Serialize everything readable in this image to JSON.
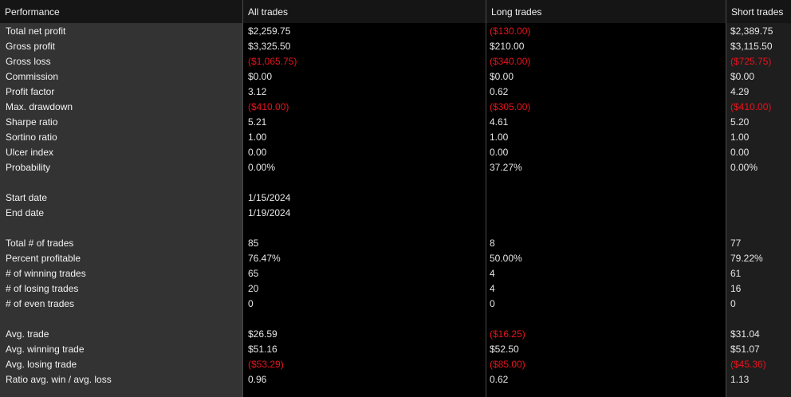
{
  "headers": {
    "performance": "Performance",
    "all": "All trades",
    "long": "Long trades",
    "short": "Short trades"
  },
  "colors": {
    "negative": "#e8141d",
    "label_column_bg": "#333333",
    "value_bg": "#000000",
    "short_column_bg": "#1e1e1e"
  },
  "rows": [
    {
      "label": "Total net profit",
      "all": "$2,259.75",
      "long": "($130.00)",
      "short": "$2,389.75"
    },
    {
      "label": "Gross profit",
      "all": "$3,325.50",
      "long": "$210.00",
      "short": "$3,115.50"
    },
    {
      "label": "Gross loss",
      "all": "($1,065.75)",
      "long": "($340.00)",
      "short": "($725.75)"
    },
    {
      "label": "Commission",
      "all": "$0.00",
      "long": "$0.00",
      "short": "$0.00"
    },
    {
      "label": "Profit factor",
      "all": "3.12",
      "long": "0.62",
      "short": "4.29"
    },
    {
      "label": "Max. drawdown",
      "all": "($410.00)",
      "long": "($305.00)",
      "short": "($410.00)"
    },
    {
      "label": "Sharpe ratio",
      "all": "5.21",
      "long": "4.61",
      "short": "5.20"
    },
    {
      "label": "Sortino ratio",
      "all": "1.00",
      "long": "1.00",
      "short": "1.00"
    },
    {
      "label": "Ulcer index",
      "all": "0.00",
      "long": "0.00",
      "short": "0.00"
    },
    {
      "label": "Probability",
      "all": "0.00%",
      "long": "37.27%",
      "short": "0.00%"
    },
    {
      "label": "",
      "all": "",
      "long": "",
      "short": ""
    },
    {
      "label": "Start date",
      "all": "1/15/2024",
      "long": "",
      "short": ""
    },
    {
      "label": "End date",
      "all": "1/19/2024",
      "long": "",
      "short": ""
    },
    {
      "label": "",
      "all": "",
      "long": "",
      "short": ""
    },
    {
      "label": "Total # of trades",
      "all": "85",
      "long": "8",
      "short": "77"
    },
    {
      "label": "Percent profitable",
      "all": "76.47%",
      "long": "50.00%",
      "short": "79.22%"
    },
    {
      "label": "# of winning trades",
      "all": "65",
      "long": "4",
      "short": "61"
    },
    {
      "label": "# of losing trades",
      "all": "20",
      "long": "4",
      "short": "16"
    },
    {
      "label": "# of even trades",
      "all": "0",
      "long": "0",
      "short": "0"
    },
    {
      "label": "",
      "all": "",
      "long": "",
      "short": ""
    },
    {
      "label": "Avg. trade",
      "all": "$26.59",
      "long": "($16.25)",
      "short": "$31.04"
    },
    {
      "label": "Avg. winning trade",
      "all": "$51.16",
      "long": "$52.50",
      "short": "$51.07"
    },
    {
      "label": "Avg. losing trade",
      "all": "($53.29)",
      "long": "($85.00)",
      "short": "($45.36)"
    },
    {
      "label": "Ratio avg. win / avg. loss",
      "all": "0.96",
      "long": "0.62",
      "short": "1.13"
    }
  ]
}
